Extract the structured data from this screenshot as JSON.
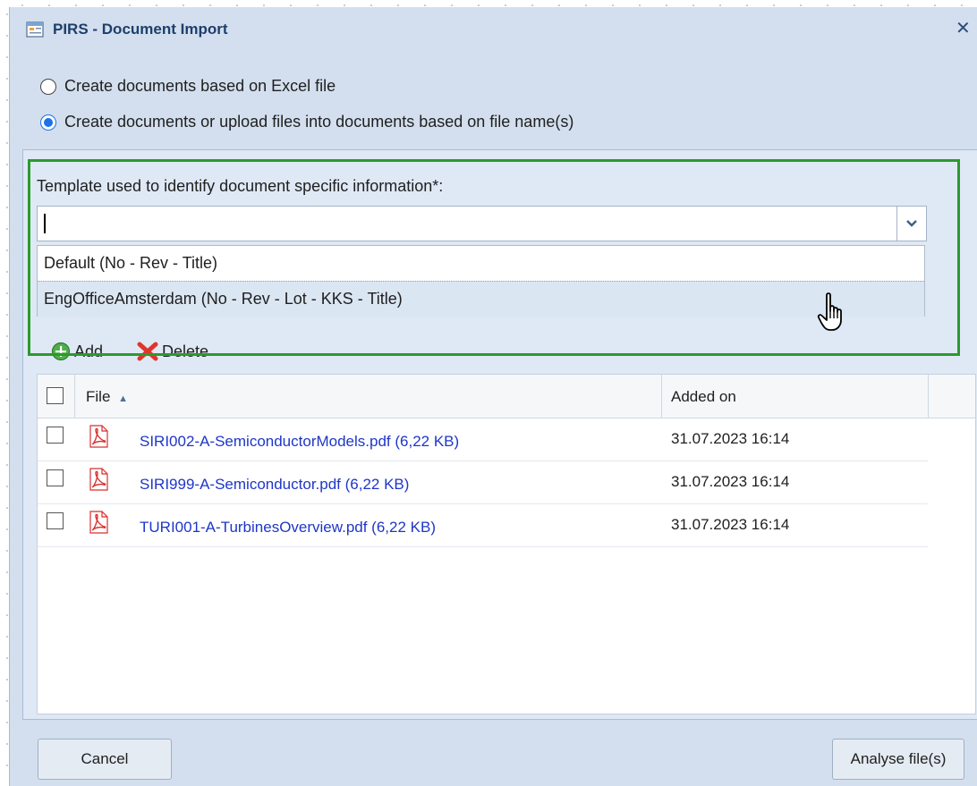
{
  "window": {
    "title": "PIRS - Document Import",
    "close_symbol": "✕"
  },
  "import_mode": {
    "options": [
      {
        "label": "Create documents based on Excel file",
        "selected": false
      },
      {
        "label": "Create documents or upload files into documents based on file name(s)",
        "selected": true
      }
    ]
  },
  "template": {
    "label": "Template used to identify document specific information*:",
    "value": "",
    "dropdown_open": true,
    "options": [
      {
        "label": "Default (No - Rev - Title)"
      },
      {
        "label": "EngOfficeAmsterdam (No - Rev - Lot - KKS - Title)",
        "hovered": true
      }
    ]
  },
  "toolbar": {
    "add_label": "Add",
    "delete_label": "Delete"
  },
  "grid": {
    "columns": {
      "file": "File",
      "added_on": "Added on"
    },
    "sort": {
      "column": "file",
      "direction": "ascending"
    },
    "rows": [
      {
        "file": "SIRI002-A-SemiconductorModels.pdf (6,22 KB)",
        "added_on": "31.07.2023 16:14"
      },
      {
        "file": "SIRI999-A-Semiconductor.pdf (6,22 KB)",
        "added_on": "31.07.2023 16:14"
      },
      {
        "file": "TURI001-A-TurbinesOverview.pdf (6,22 KB)",
        "added_on": "31.07.2023 16:14"
      }
    ]
  },
  "footer": {
    "cancel_label": "Cancel",
    "analyse_label": "Analyse file(s)"
  },
  "colors": {
    "window_bg": "#d3dfee",
    "highlight": "#2c9a2c",
    "link": "#1e36c8",
    "pdf_red": "#d8302f"
  }
}
